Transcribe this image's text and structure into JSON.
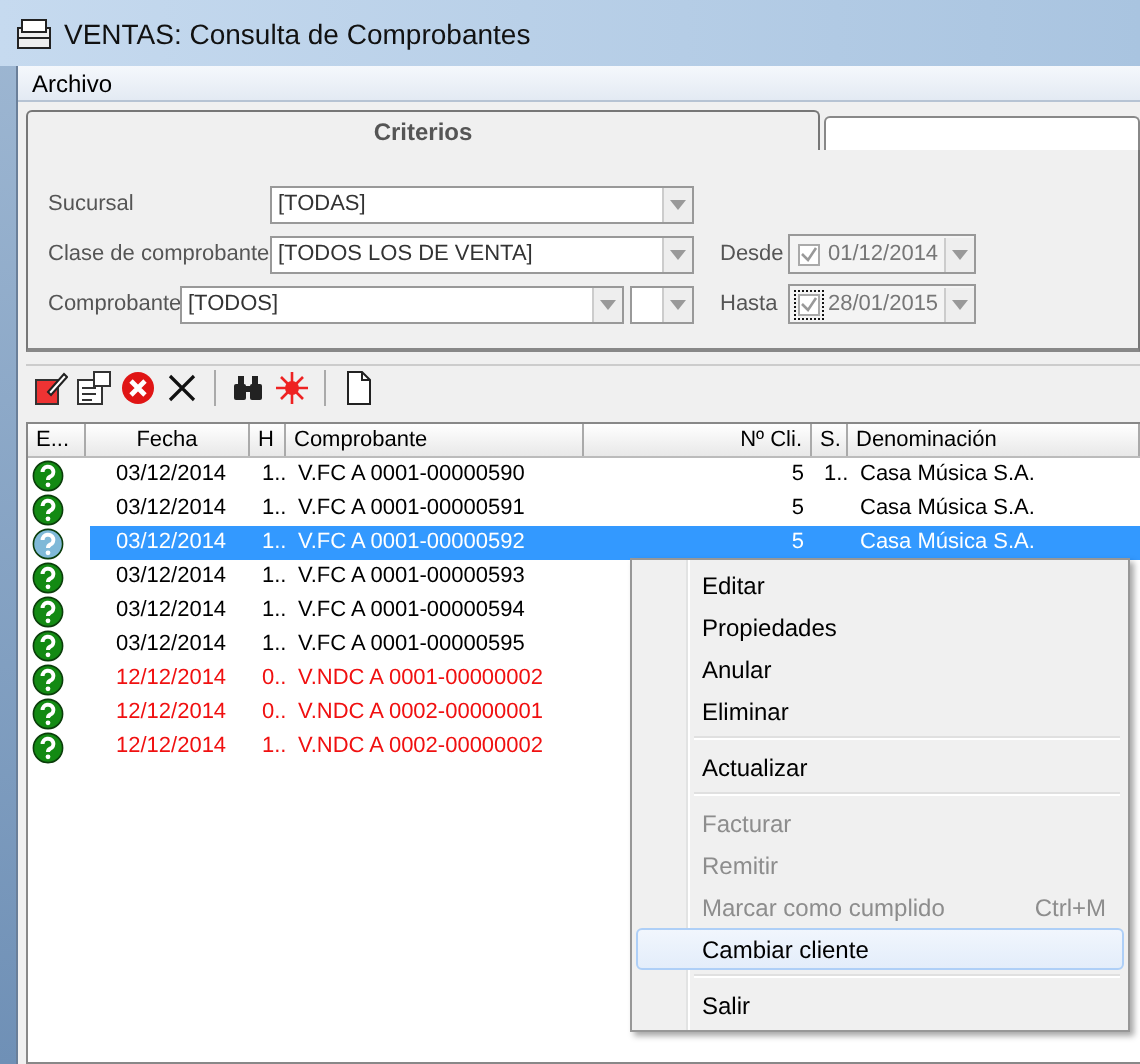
{
  "window": {
    "title": "VENTAS: Consulta de Comprobantes"
  },
  "menu_bar": [
    "Archivo"
  ],
  "tabs": [
    {
      "label": "Criterios",
      "selected": true
    },
    {
      "selected": false
    }
  ],
  "criteria": {
    "sucursal": {
      "label": "Sucursal",
      "value": "[TODAS]"
    },
    "clase": {
      "label": "Clase de comprobante",
      "value": "[TODOS LOS DE VENTA]"
    },
    "comprobante": {
      "label": "Comprobante",
      "value": "[TODOS]"
    },
    "desde": {
      "label": "Desde",
      "checked": true,
      "focused": false,
      "value": "01/12/2014"
    },
    "hasta": {
      "label": "Hasta",
      "checked": true,
      "focused": true,
      "value": "28/01/2015"
    }
  },
  "table": {
    "columns": [
      "E...",
      "Fecha",
      "H",
      "Comprobante",
      "Nº Cli.",
      "S.",
      "Denominación"
    ],
    "rows": [
      {
        "kind": "invoice",
        "selected": false,
        "fecha": "03/12/2014",
        "h": "1..",
        "comprobante": "V.FC A 0001-00000590",
        "cliente": "5",
        "s": "1..",
        "denominacion": "Casa Música S.A."
      },
      {
        "kind": "invoice",
        "selected": false,
        "fecha": "03/12/2014",
        "h": "1..",
        "comprobante": "V.FC A 0001-00000591",
        "cliente": "5",
        "denominacion": "Casa Música S.A."
      },
      {
        "kind": "invoice",
        "selected": true,
        "fecha": "03/12/2014",
        "h": "1..",
        "comprobante": "V.FC A 0001-00000592",
        "cliente": "5",
        "denominacion": "Casa Música S.A."
      },
      {
        "kind": "invoice",
        "selected": false,
        "fecha": "03/12/2014",
        "h": "1..",
        "comprobante": "V.FC A 0001-00000593"
      },
      {
        "kind": "invoice",
        "selected": false,
        "fecha": "03/12/2014",
        "h": "1..",
        "comprobante": "V.FC A 0001-00000594"
      },
      {
        "kind": "invoice",
        "selected": false,
        "fecha": "03/12/2014",
        "h": "1..",
        "comprobante": "V.FC A 0001-00000595"
      },
      {
        "kind": "credit_note",
        "selected": false,
        "fecha": "12/12/2014",
        "h": "0..",
        "comprobante": "V.NDC A 0001-00000002"
      },
      {
        "kind": "credit_note",
        "selected": false,
        "fecha": "12/12/2014",
        "h": "0..",
        "comprobante": "V.NDC A 0002-00000001"
      },
      {
        "kind": "credit_note",
        "selected": false,
        "fecha": "12/12/2014",
        "h": "1..",
        "comprobante": "V.NDC A 0002-00000002"
      }
    ]
  },
  "context_menu": {
    "items": [
      {
        "kind": "item",
        "label": "Editar",
        "disabled": false,
        "selected": false
      },
      {
        "kind": "item",
        "label": "Propiedades",
        "disabled": false,
        "selected": false
      },
      {
        "kind": "item",
        "label": "Anular",
        "disabled": false,
        "selected": false
      },
      {
        "kind": "item",
        "label": "Eliminar",
        "disabled": false,
        "selected": false
      },
      {
        "kind": "separator"
      },
      {
        "kind": "item",
        "label": "Actualizar",
        "disabled": false,
        "selected": false
      },
      {
        "kind": "separator"
      },
      {
        "kind": "item",
        "label": "Facturar",
        "disabled": true,
        "selected": false
      },
      {
        "kind": "item",
        "label": "Remitir",
        "disabled": true,
        "selected": false
      },
      {
        "kind": "item",
        "label": "Marcar como cumplido",
        "shortcut": "Ctrl+M",
        "disabled": true,
        "selected": false
      },
      {
        "kind": "item",
        "label": "Cambiar cliente",
        "disabled": false,
        "selected": true
      },
      {
        "kind": "separator"
      },
      {
        "kind": "item",
        "label": "Salir",
        "disabled": false,
        "selected": false
      }
    ]
  }
}
